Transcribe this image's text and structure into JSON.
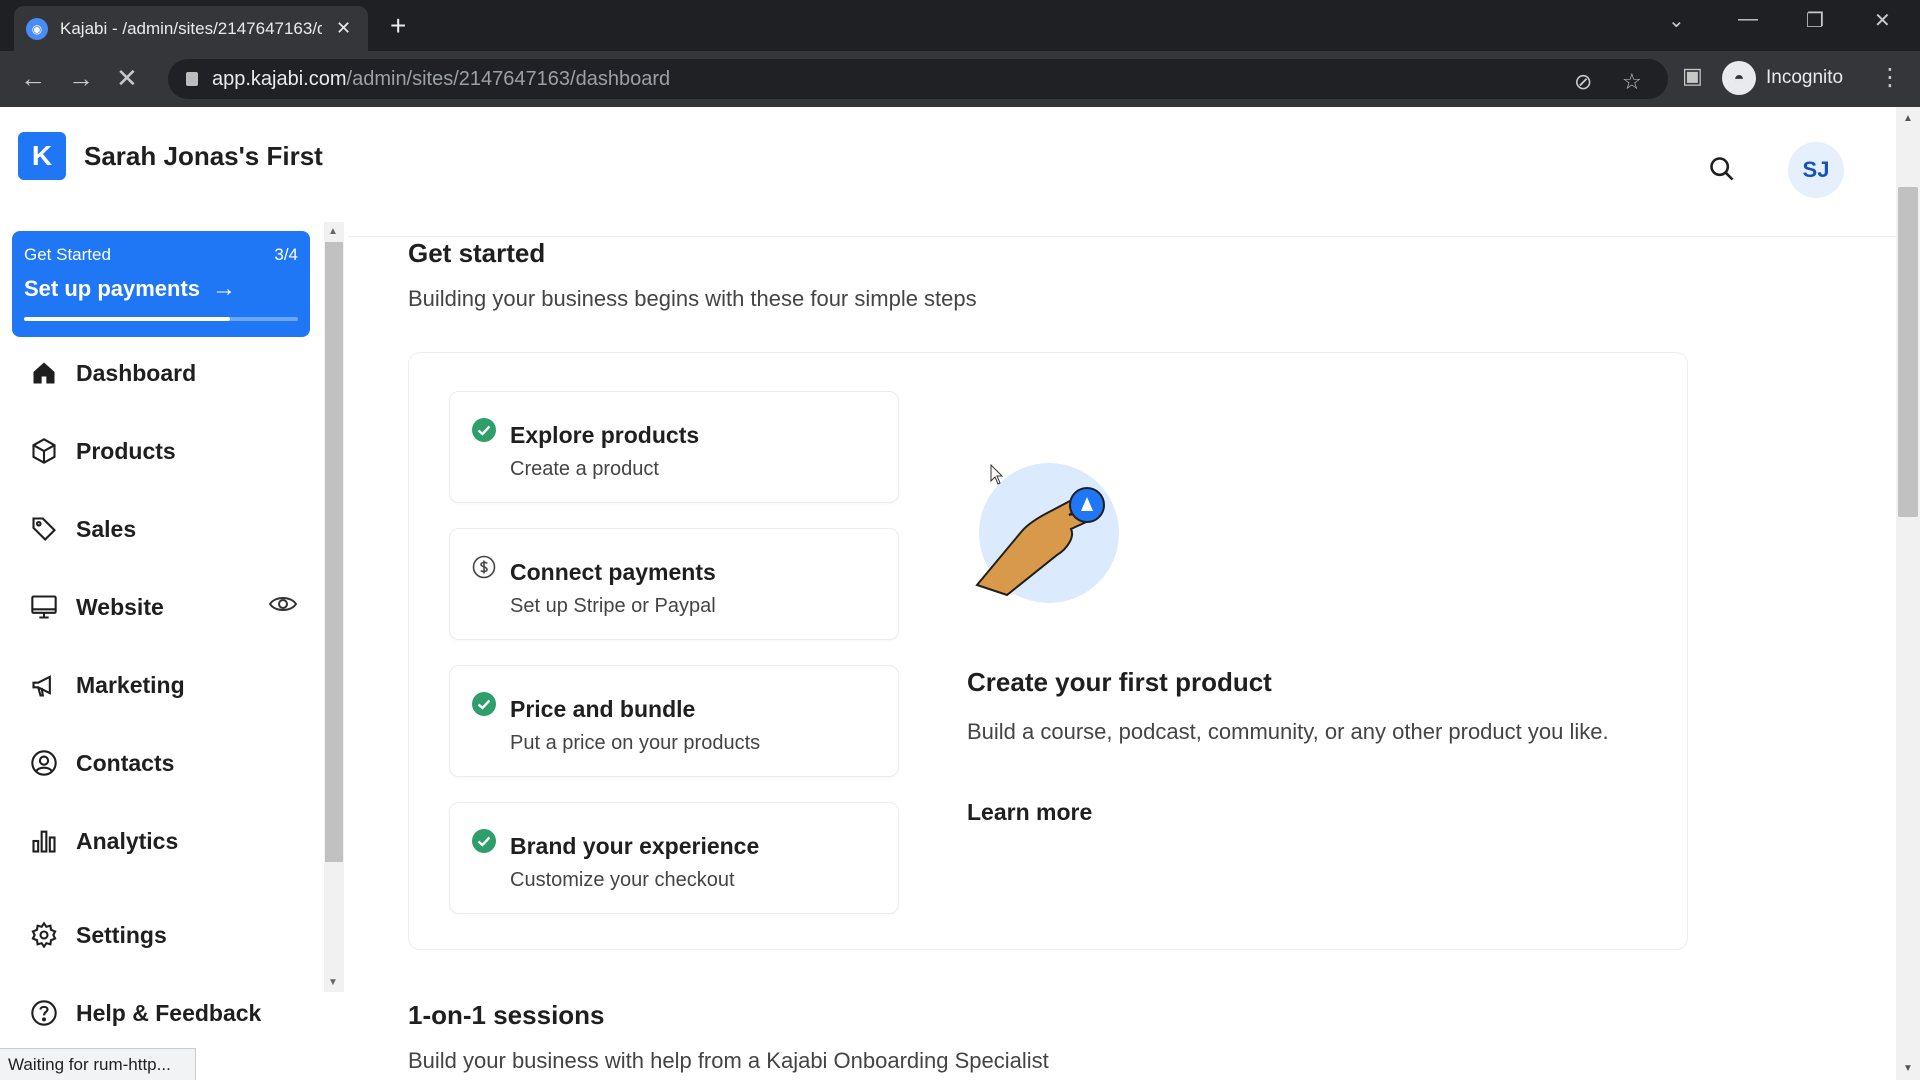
{
  "browser": {
    "tab_title": "Kajabi - /admin/sites/2147647163/dashboard",
    "url_host": "app.kajabi.com",
    "url_path": "/admin/sites/2147647163/dashboard",
    "profile_label": "Incognito",
    "status_text": "Waiting for rum-http..."
  },
  "sidebar": {
    "brand_name": "Sarah Jonas's First",
    "brand_logo": "K",
    "get_started": {
      "label": "Get Started",
      "progress_text": "3/4",
      "progress": 0.75,
      "action": "Set up payments"
    },
    "items": [
      {
        "label": "Dashboard",
        "icon": "home-icon"
      },
      {
        "label": "Products",
        "icon": "box-icon"
      },
      {
        "label": "Sales",
        "icon": "tag-icon"
      },
      {
        "label": "Website",
        "icon": "monitor-icon"
      },
      {
        "label": "Marketing",
        "icon": "megaphone-icon"
      },
      {
        "label": "Contacts",
        "icon": "contact-icon"
      },
      {
        "label": "Analytics",
        "icon": "bar-chart-icon"
      },
      {
        "label": "Settings",
        "icon": "gear-icon"
      },
      {
        "label": "Help & Feedback",
        "icon": "help-icon"
      }
    ]
  },
  "header": {
    "avatar_initials": "SJ"
  },
  "main": {
    "get_started": {
      "title": "Get started",
      "subtitle": "Building your business begins with these four simple steps",
      "steps": [
        {
          "title": "Explore products",
          "subtitle": "Create a product",
          "completed": true
        },
        {
          "title": "Connect payments",
          "subtitle": "Set up Stripe or Paypal",
          "completed": false
        },
        {
          "title": "Price and bundle",
          "subtitle": "Put a price on your products",
          "completed": true
        },
        {
          "title": "Brand your experience",
          "subtitle": "Customize your checkout",
          "completed": true
        }
      ],
      "detail": {
        "title": "Create your first product",
        "text": "Build a course, podcast, community, or any other product you like.",
        "link": "Learn more"
      }
    },
    "sessions": {
      "title": "1-on-1 sessions",
      "subtitle": "Build your business with help from a Kajabi Onboarding Specialist"
    }
  },
  "colors": {
    "accent": "#1f77f5",
    "success": "#2e9e6b"
  }
}
